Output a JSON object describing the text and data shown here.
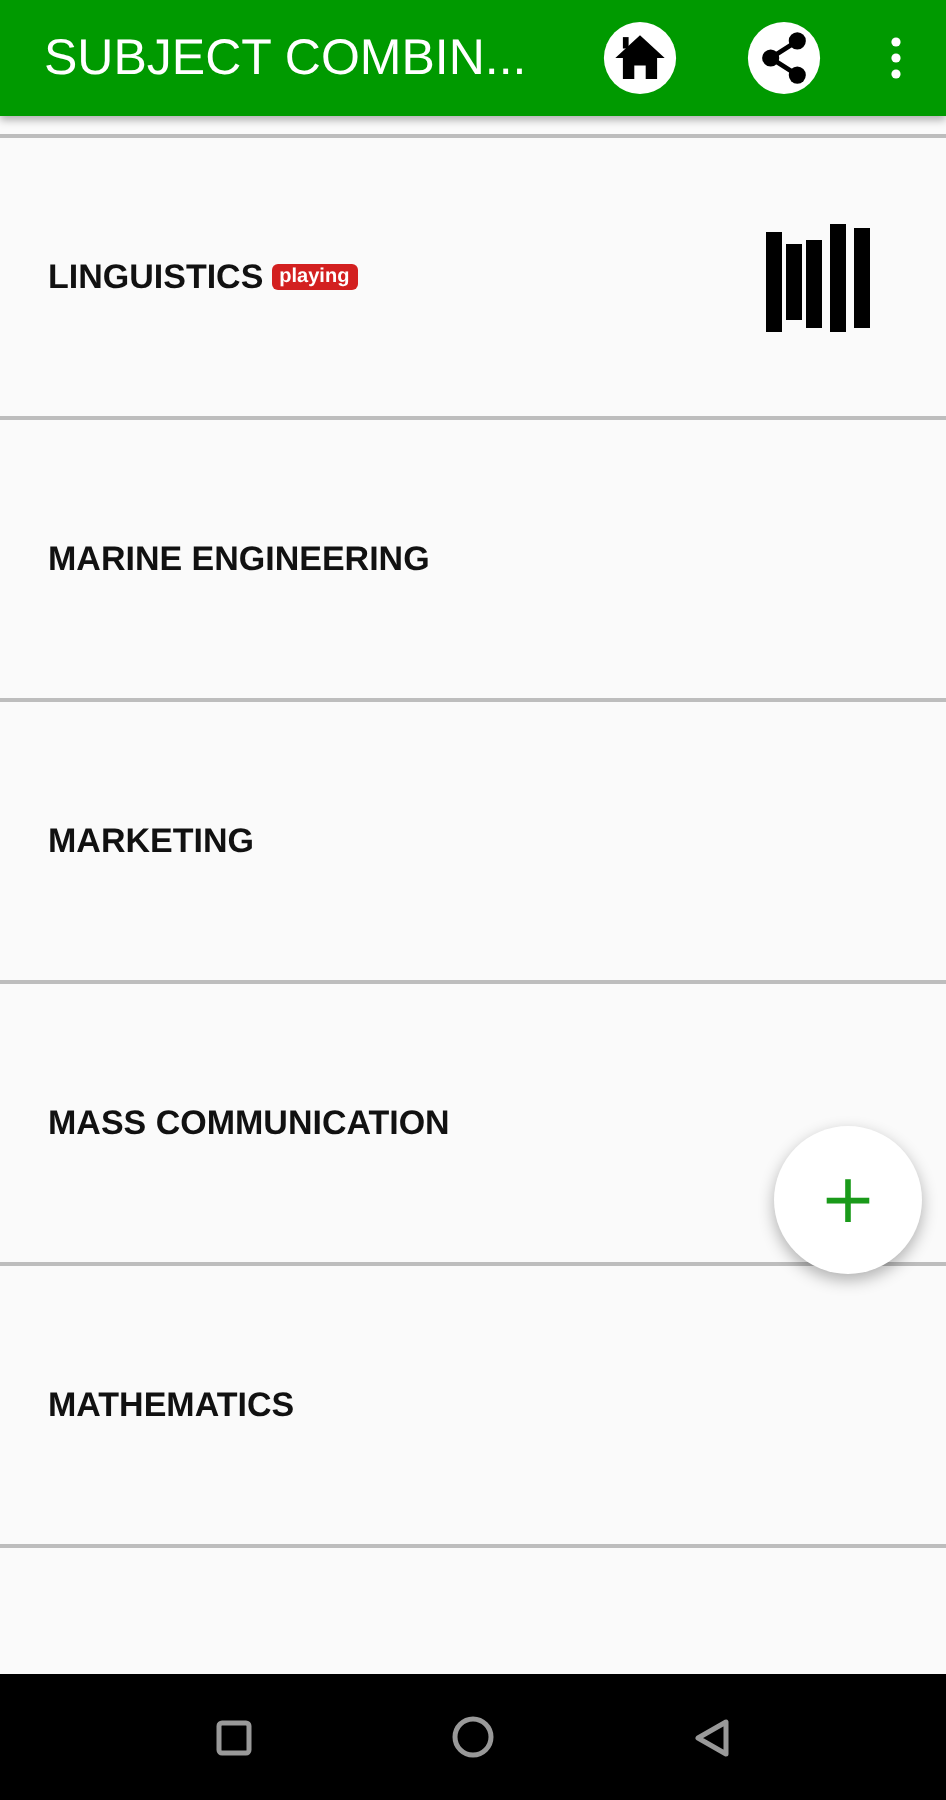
{
  "app_bar": {
    "title": "SUBJECT COMBIN..."
  },
  "items": [
    {
      "label": "LINGUISTICS",
      "badge": "playing",
      "playing": true
    },
    {
      "label": "MARINE ENGINEERING",
      "playing": false
    },
    {
      "label": "MARKETING",
      "playing": false
    },
    {
      "label": "MASS COMMUNICATION",
      "playing": false
    },
    {
      "label": "MATHEMATICS",
      "playing": false
    }
  ],
  "fab": {
    "symbol": "+"
  }
}
